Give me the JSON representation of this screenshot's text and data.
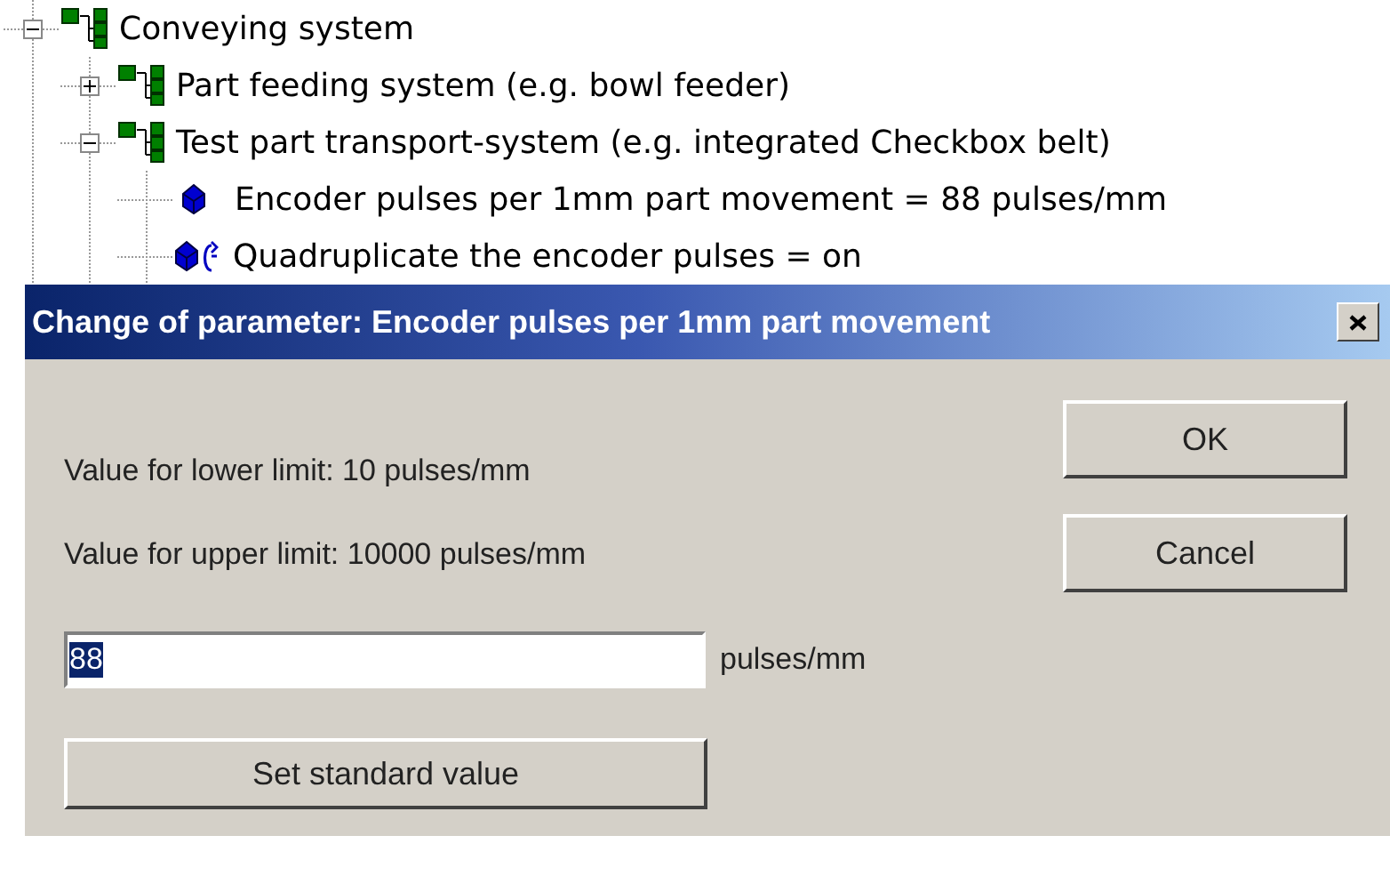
{
  "tree": [
    {
      "label": "Conveying system",
      "kind": "group",
      "expanded": true,
      "children": [
        {
          "label": "Part feeding system (e.g. bowl feeder)",
          "kind": "group",
          "expanded": false
        },
        {
          "label": "Test part transport-system (e.g. integrated Checkbox belt)",
          "kind": "group",
          "expanded": true,
          "children": [
            {
              "label": "Encoder pulses per 1mm part movement = 88 pulses/mm",
              "kind": "value"
            },
            {
              "label": "Quadruplicate the encoder pulses = on",
              "kind": "toggle"
            }
          ]
        }
      ]
    }
  ],
  "dialog": {
    "title": "Change of parameter: Encoder pulses per 1mm part movement",
    "lower_limit": "Value for lower limit: 10 pulses/mm",
    "upper_limit": "Value for upper limit: 10000 pulses/mm",
    "value": "88",
    "value_selected": true,
    "unit": "pulses/mm",
    "standard_button": "Set standard value",
    "buttons": [
      "OK",
      "Cancel"
    ]
  }
}
